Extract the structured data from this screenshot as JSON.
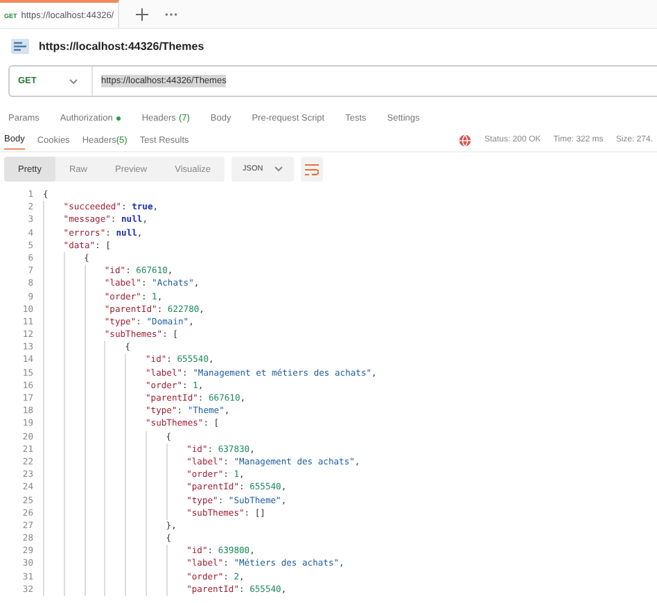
{
  "tabs": [
    {
      "method": "GET",
      "label": "https://localhost:44326/",
      "selected": true
    }
  ],
  "request": {
    "title": "https://localhost:44326/Themes",
    "method": "GET",
    "url": "https://localhost:44326/Themes"
  },
  "request_tabs": [
    {
      "label": "Params",
      "dot": false
    },
    {
      "label": "Authorization",
      "dot": true
    },
    {
      "label": "Headers",
      "badge": "(7)",
      "dot": false
    },
    {
      "label": "Body",
      "dot": false
    },
    {
      "label": "Pre-request Script",
      "dot": false
    },
    {
      "label": "Tests",
      "dot": false
    },
    {
      "label": "Settings",
      "dot": false
    }
  ],
  "response_tabs": [
    {
      "label": "Body",
      "selected": true
    },
    {
      "label": "Cookies",
      "selected": false
    },
    {
      "label": "Headers",
      "badge": "(5)",
      "selected": false
    },
    {
      "label": "Test Results",
      "selected": false
    }
  ],
  "status": {
    "status": "Status: 200 OK",
    "time": "Time: 322 ms",
    "size": "Size: 274."
  },
  "view_modes": [
    {
      "label": "Pretty",
      "selected": true
    },
    {
      "label": "Raw",
      "selected": false
    },
    {
      "label": "Preview",
      "selected": false
    },
    {
      "label": "Visualize",
      "selected": false
    }
  ],
  "format": "JSON",
  "code_lines": [
    {
      "n": "1",
      "text": "{"
    },
    {
      "n": "2",
      "text": "    \"succeeded\": true,"
    },
    {
      "n": "3",
      "text": "    \"message\": null,"
    },
    {
      "n": "4",
      "text": "    \"errors\": null,"
    },
    {
      "n": "5",
      "text": "    \"data\": ["
    },
    {
      "n": "6",
      "text": "        {"
    },
    {
      "n": "7",
      "text": "            \"id\": 667610,"
    },
    {
      "n": "8",
      "text": "            \"label\": \"Achats\","
    },
    {
      "n": "9",
      "text": "            \"order\": 1,"
    },
    {
      "n": "10",
      "text": "            \"parentId\": 622780,"
    },
    {
      "n": "11",
      "text": "            \"type\": \"Domain\","
    },
    {
      "n": "12",
      "text": "            \"subThemes\": ["
    },
    {
      "n": "13",
      "text": "                {"
    },
    {
      "n": "14",
      "text": "                    \"id\": 655540,"
    },
    {
      "n": "15",
      "text": "                    \"label\": \"Management et métiers des achats\","
    },
    {
      "n": "16",
      "text": "                    \"order\": 1,"
    },
    {
      "n": "17",
      "text": "                    \"parentId\": 667610,"
    },
    {
      "n": "18",
      "text": "                    \"type\": \"Theme\","
    },
    {
      "n": "19",
      "text": "                    \"subThemes\": ["
    },
    {
      "n": "20",
      "text": "                        {"
    },
    {
      "n": "21",
      "text": "                            \"id\": 637830,"
    },
    {
      "n": "22",
      "text": "                            \"label\": \"Management des achats\","
    },
    {
      "n": "23",
      "text": "                            \"order\": 1,"
    },
    {
      "n": "24",
      "text": "                            \"parentId\": 655540,"
    },
    {
      "n": "25",
      "text": "                            \"type\": \"SubTheme\","
    },
    {
      "n": "26",
      "text": "                            \"subThemes\": []"
    },
    {
      "n": "27",
      "text": "                        },"
    },
    {
      "n": "28",
      "text": "                        {"
    },
    {
      "n": "29",
      "text": "                            \"id\": 639800,"
    },
    {
      "n": "30",
      "text": "                            \"label\": \"Métiers des achats\","
    },
    {
      "n": "31",
      "text": "                            \"order\": 2,"
    },
    {
      "n": "32",
      "text": "                            \"parentId\": 655540,"
    }
  ]
}
